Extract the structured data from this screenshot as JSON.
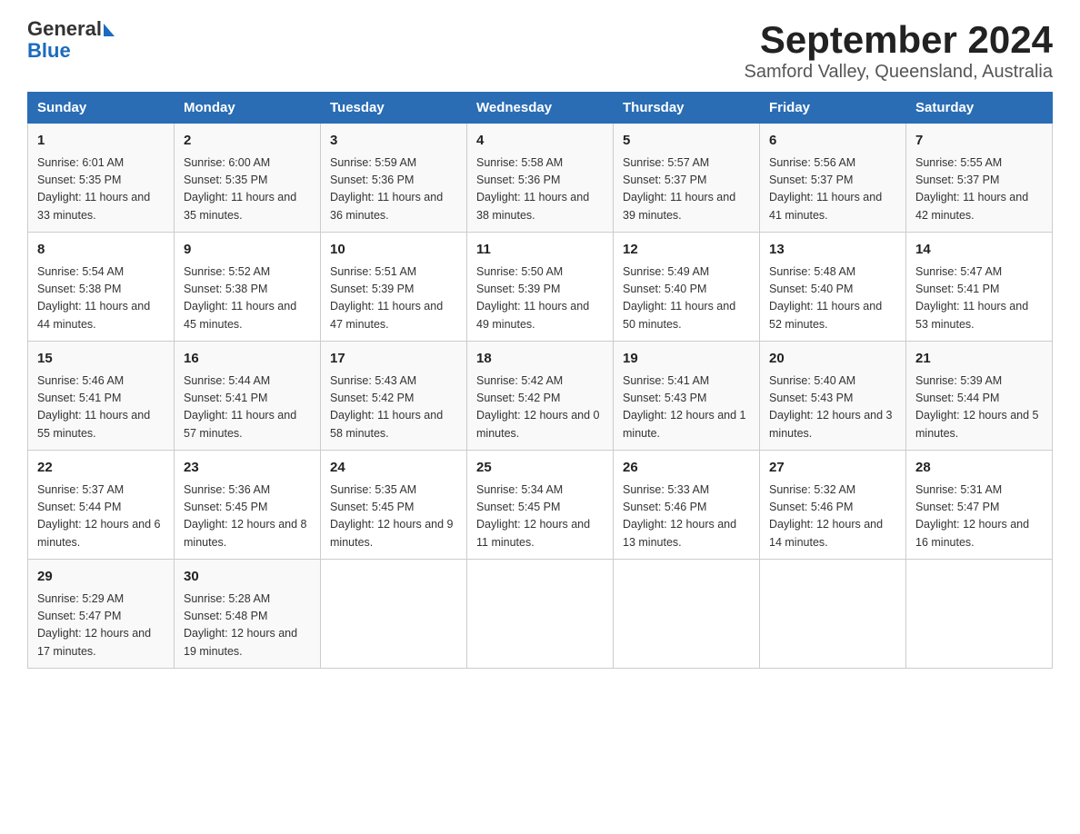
{
  "logo": {
    "general": "General",
    "blue": "Blue"
  },
  "title": "September 2024",
  "subtitle": "Samford Valley, Queensland, Australia",
  "days_of_week": [
    "Sunday",
    "Monday",
    "Tuesday",
    "Wednesday",
    "Thursday",
    "Friday",
    "Saturday"
  ],
  "weeks": [
    [
      {
        "day": "1",
        "sunrise": "6:01 AM",
        "sunset": "5:35 PM",
        "daylight": "11 hours and 33 minutes."
      },
      {
        "day": "2",
        "sunrise": "6:00 AM",
        "sunset": "5:35 PM",
        "daylight": "11 hours and 35 minutes."
      },
      {
        "day": "3",
        "sunrise": "5:59 AM",
        "sunset": "5:36 PM",
        "daylight": "11 hours and 36 minutes."
      },
      {
        "day": "4",
        "sunrise": "5:58 AM",
        "sunset": "5:36 PM",
        "daylight": "11 hours and 38 minutes."
      },
      {
        "day": "5",
        "sunrise": "5:57 AM",
        "sunset": "5:37 PM",
        "daylight": "11 hours and 39 minutes."
      },
      {
        "day": "6",
        "sunrise": "5:56 AM",
        "sunset": "5:37 PM",
        "daylight": "11 hours and 41 minutes."
      },
      {
        "day": "7",
        "sunrise": "5:55 AM",
        "sunset": "5:37 PM",
        "daylight": "11 hours and 42 minutes."
      }
    ],
    [
      {
        "day": "8",
        "sunrise": "5:54 AM",
        "sunset": "5:38 PM",
        "daylight": "11 hours and 44 minutes."
      },
      {
        "day": "9",
        "sunrise": "5:52 AM",
        "sunset": "5:38 PM",
        "daylight": "11 hours and 45 minutes."
      },
      {
        "day": "10",
        "sunrise": "5:51 AM",
        "sunset": "5:39 PM",
        "daylight": "11 hours and 47 minutes."
      },
      {
        "day": "11",
        "sunrise": "5:50 AM",
        "sunset": "5:39 PM",
        "daylight": "11 hours and 49 minutes."
      },
      {
        "day": "12",
        "sunrise": "5:49 AM",
        "sunset": "5:40 PM",
        "daylight": "11 hours and 50 minutes."
      },
      {
        "day": "13",
        "sunrise": "5:48 AM",
        "sunset": "5:40 PM",
        "daylight": "11 hours and 52 minutes."
      },
      {
        "day": "14",
        "sunrise": "5:47 AM",
        "sunset": "5:41 PM",
        "daylight": "11 hours and 53 minutes."
      }
    ],
    [
      {
        "day": "15",
        "sunrise": "5:46 AM",
        "sunset": "5:41 PM",
        "daylight": "11 hours and 55 minutes."
      },
      {
        "day": "16",
        "sunrise": "5:44 AM",
        "sunset": "5:41 PM",
        "daylight": "11 hours and 57 minutes."
      },
      {
        "day": "17",
        "sunrise": "5:43 AM",
        "sunset": "5:42 PM",
        "daylight": "11 hours and 58 minutes."
      },
      {
        "day": "18",
        "sunrise": "5:42 AM",
        "sunset": "5:42 PM",
        "daylight": "12 hours and 0 minutes."
      },
      {
        "day": "19",
        "sunrise": "5:41 AM",
        "sunset": "5:43 PM",
        "daylight": "12 hours and 1 minute."
      },
      {
        "day": "20",
        "sunrise": "5:40 AM",
        "sunset": "5:43 PM",
        "daylight": "12 hours and 3 minutes."
      },
      {
        "day": "21",
        "sunrise": "5:39 AM",
        "sunset": "5:44 PM",
        "daylight": "12 hours and 5 minutes."
      }
    ],
    [
      {
        "day": "22",
        "sunrise": "5:37 AM",
        "sunset": "5:44 PM",
        "daylight": "12 hours and 6 minutes."
      },
      {
        "day": "23",
        "sunrise": "5:36 AM",
        "sunset": "5:45 PM",
        "daylight": "12 hours and 8 minutes."
      },
      {
        "day": "24",
        "sunrise": "5:35 AM",
        "sunset": "5:45 PM",
        "daylight": "12 hours and 9 minutes."
      },
      {
        "day": "25",
        "sunrise": "5:34 AM",
        "sunset": "5:45 PM",
        "daylight": "12 hours and 11 minutes."
      },
      {
        "day": "26",
        "sunrise": "5:33 AM",
        "sunset": "5:46 PM",
        "daylight": "12 hours and 13 minutes."
      },
      {
        "day": "27",
        "sunrise": "5:32 AM",
        "sunset": "5:46 PM",
        "daylight": "12 hours and 14 minutes."
      },
      {
        "day": "28",
        "sunrise": "5:31 AM",
        "sunset": "5:47 PM",
        "daylight": "12 hours and 16 minutes."
      }
    ],
    [
      {
        "day": "29",
        "sunrise": "5:29 AM",
        "sunset": "5:47 PM",
        "daylight": "12 hours and 17 minutes."
      },
      {
        "day": "30",
        "sunrise": "5:28 AM",
        "sunset": "5:48 PM",
        "daylight": "12 hours and 19 minutes."
      },
      null,
      null,
      null,
      null,
      null
    ]
  ]
}
